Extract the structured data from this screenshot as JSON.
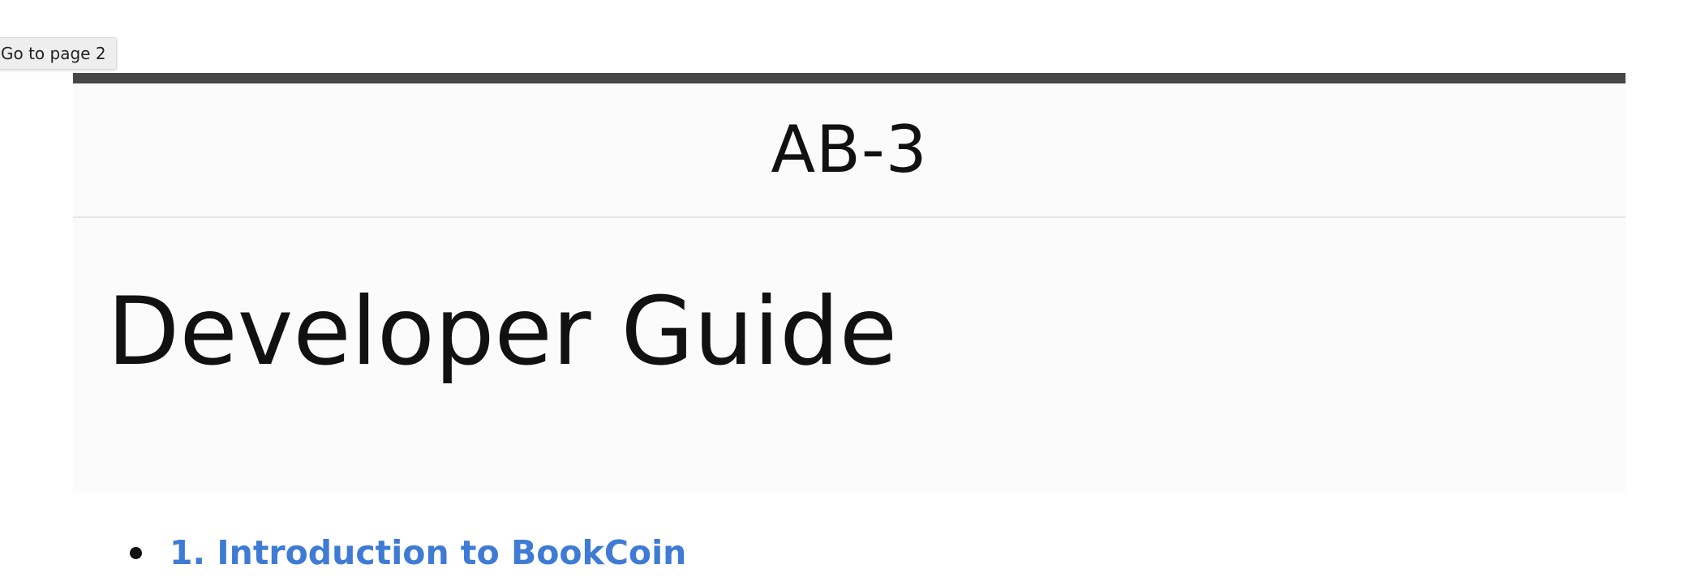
{
  "tooltip": {
    "goto_label": "Go to page 2"
  },
  "header": {
    "site_title": "AB-3"
  },
  "main": {
    "page_title": "Developer Guide",
    "toc": [
      {
        "label": "1. Introduction to BookCoin"
      }
    ]
  },
  "colors": {
    "top_rule": "#474747",
    "link": "#3f7bd4",
    "page_background": "#fbfbfb"
  }
}
